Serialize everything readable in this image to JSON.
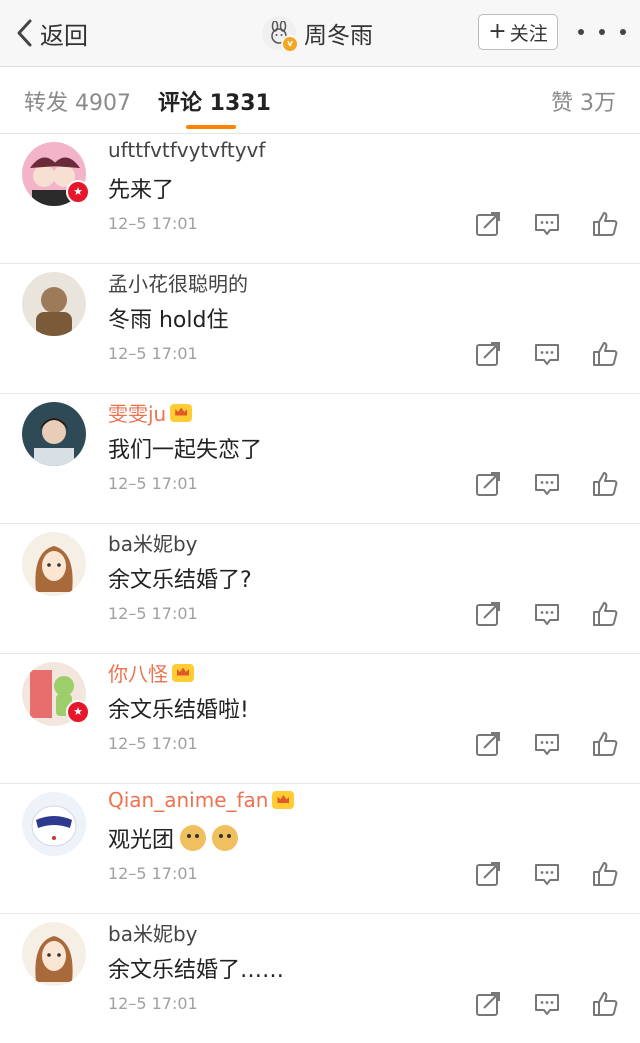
{
  "nav": {
    "back_label": "返回",
    "title": "周冬雨",
    "follow_label": "关注",
    "follow_plus": "+"
  },
  "tabs": {
    "repost": "转发 4907",
    "comment": "评论 1331",
    "likes": "赞 3万"
  },
  "colors": {
    "accent": "#ff8200",
    "vip_name": "#eb7350",
    "badge_red": "#e6162d",
    "time_gray": "#a0a0a0"
  },
  "comments": [
    {
      "name": "ufttfvtfvytvftyvf",
      "text": "先来了",
      "time": "12–5 17:01",
      "vip": false,
      "badge": true,
      "emoji_count": 0
    },
    {
      "name": "孟小花很聪明的",
      "text": "冬雨 hold住",
      "time": "12–5 17:01",
      "vip": false,
      "badge": false,
      "emoji_count": 0
    },
    {
      "name": "雯雯ju",
      "text": "我们一起失恋了",
      "time": "12–5 17:01",
      "vip": true,
      "badge": false,
      "emoji_count": 0
    },
    {
      "name": "ba米妮by",
      "text": "余文乐结婚了?",
      "time": "12–5 17:01",
      "vip": false,
      "badge": false,
      "emoji_count": 0
    },
    {
      "name": "你八怪",
      "text": "余文乐结婚啦!",
      "time": "12–5 17:01",
      "vip": true,
      "badge": true,
      "emoji_count": 0
    },
    {
      "name": "Qian_anime_fan",
      "text": "观光团",
      "time": "12–5 17:01",
      "vip": true,
      "badge": false,
      "emoji_count": 2
    },
    {
      "name": "ba米妮by",
      "text": "余文乐结婚了……",
      "time": "12–5 17:01",
      "vip": false,
      "badge": false,
      "emoji_count": 0
    }
  ],
  "icons": {
    "back": "chevron-left-icon",
    "more": "more-dots-icon",
    "repost": "repost-icon",
    "reply": "comment-icon",
    "like": "thumbs-up-icon"
  }
}
